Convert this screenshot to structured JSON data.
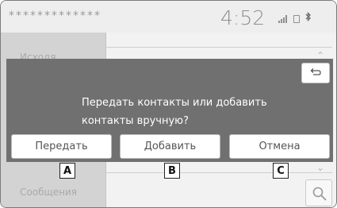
{
  "status": {
    "title_masked": "*************",
    "time": "4:52",
    "bluetooth_glyph": "ʙ"
  },
  "background": {
    "item_faded_1": "Исходя",
    "item_faded_2": "Сообщения"
  },
  "dialog": {
    "message_line1": "Передать контакты или добавить",
    "message_line2": "контакты вручную?",
    "buttons": {
      "transfer": "Передать",
      "add": "Добавить",
      "cancel": "Отмена"
    },
    "back_icon": "return-arrow-icon"
  },
  "callouts": {
    "a": "A",
    "b": "B",
    "c": "C"
  },
  "colors": {
    "dialog_bg": "#707070",
    "button_bg": "#ffffff",
    "button_text": "#555555"
  }
}
